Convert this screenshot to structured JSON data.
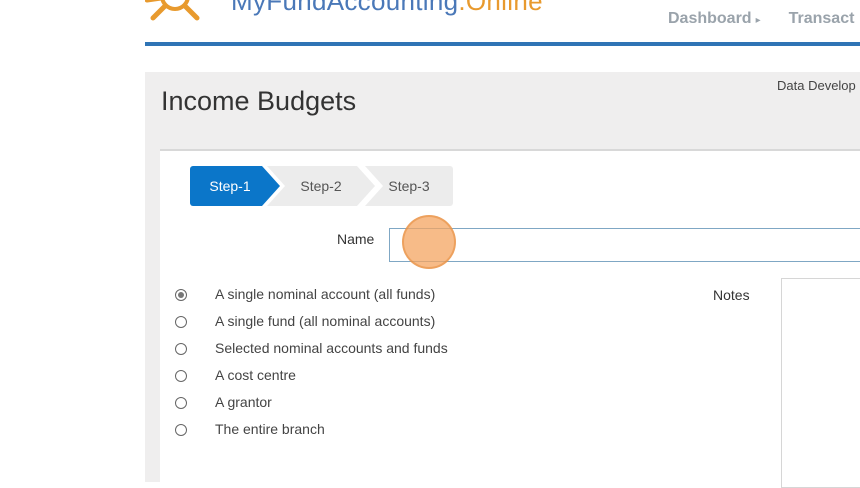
{
  "brand": {
    "logo_parts": [
      "My",
      "FundAccounting",
      ".Online"
    ],
    "colors": {
      "primary": "#2f74b5",
      "accent": "#e89a2e",
      "step_active": "#0b76c9",
      "cursor": "#f4a460"
    }
  },
  "nav": {
    "items": [
      {
        "label": "Dashboard",
        "icon": "triangle-right-icon"
      },
      {
        "label": "Transact"
      }
    ]
  },
  "page": {
    "title": "Income Budgets",
    "top_right_text": "Data Develop"
  },
  "wizard": {
    "steps": [
      {
        "label": "Step-1",
        "active": true
      },
      {
        "label": "Step-2",
        "active": false
      },
      {
        "label": "Step-3",
        "active": false
      }
    ]
  },
  "form": {
    "name_label": "Name",
    "name_value": "",
    "notes_label": "Notes",
    "notes_value": "",
    "options": [
      {
        "label": "A single nominal account (all funds)",
        "checked": true
      },
      {
        "label": "A single fund (all nominal accounts)",
        "checked": false
      },
      {
        "label": "Selected nominal accounts and funds",
        "checked": false
      },
      {
        "label": "A cost centre",
        "checked": false
      },
      {
        "label": "A grantor",
        "checked": false
      },
      {
        "label": "The entire branch",
        "checked": false
      }
    ]
  }
}
